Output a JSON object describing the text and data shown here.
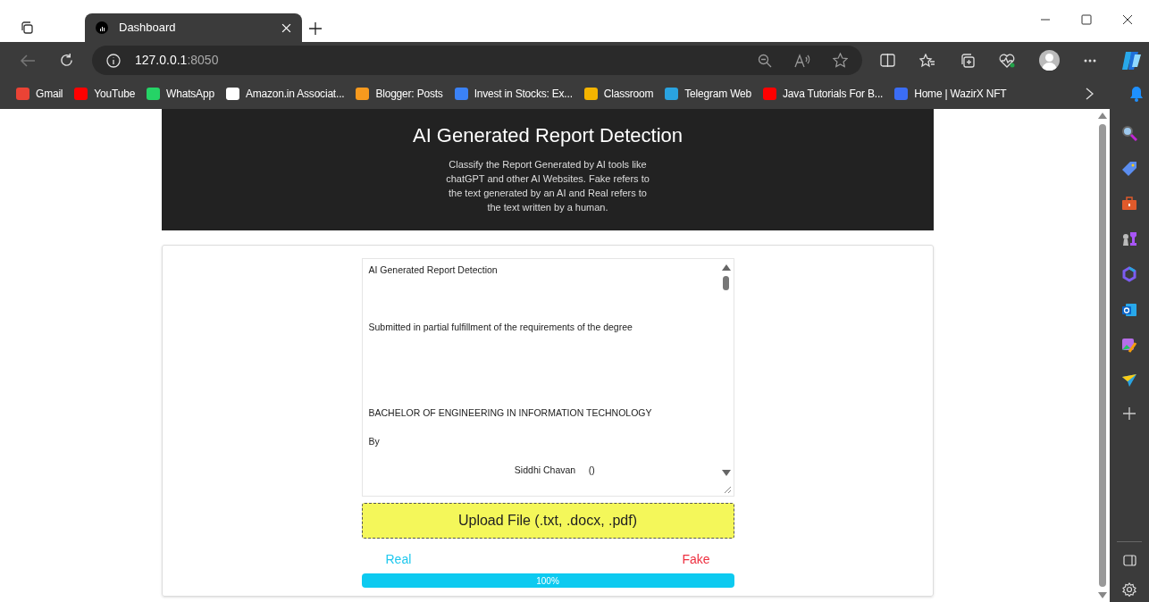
{
  "browser": {
    "tab": {
      "title": "Dashboard",
      "selected": true
    },
    "address": {
      "host": "127.0.0.1",
      "port": ":8050"
    },
    "bookmarks": [
      {
        "label": "Gmail",
        "color": "#ea4335"
      },
      {
        "label": "YouTube",
        "color": "#ff0000"
      },
      {
        "label": "WhatsApp",
        "color": "#25d366"
      },
      {
        "label": "Amazon.in Associat...",
        "color": "#ffffff"
      },
      {
        "label": "Blogger: Posts",
        "color": "#f79a1e"
      },
      {
        "label": "Invest in Stocks: Ex...",
        "color": "#3b82f6"
      },
      {
        "label": "Classroom",
        "color": "#f4b400"
      },
      {
        "label": "Telegram Web",
        "color": "#2aa3e0"
      },
      {
        "label": "Java Tutorials For B...",
        "color": "#ff0000"
      },
      {
        "label": "Home | WazirX NFT",
        "color": "#3b6df5"
      }
    ]
  },
  "header": {
    "title": "AI Generated Report Detection",
    "description": "Classify the Report Generated by AI tools like chatGPT and other AI Websites. Fake refers to the text generated by an AI and Real refers to the text written by a human."
  },
  "report_text": "AI Generated Report Detection\n\n\n\nSubmitted in partial fulfillment of the requirements of the degree\n\n\n\n\n\nBACHELOR OF ENGINEERING IN INFORMATION TECHNOLOGY\n\nBy\n\n                                                        Siddhi Chavan     ()",
  "upload_button": "Upload File (.txt, .docx, .pdf)",
  "result": {
    "real_label": "Real",
    "fake_label": "Fake",
    "level": 1,
    "reading": "100%"
  }
}
